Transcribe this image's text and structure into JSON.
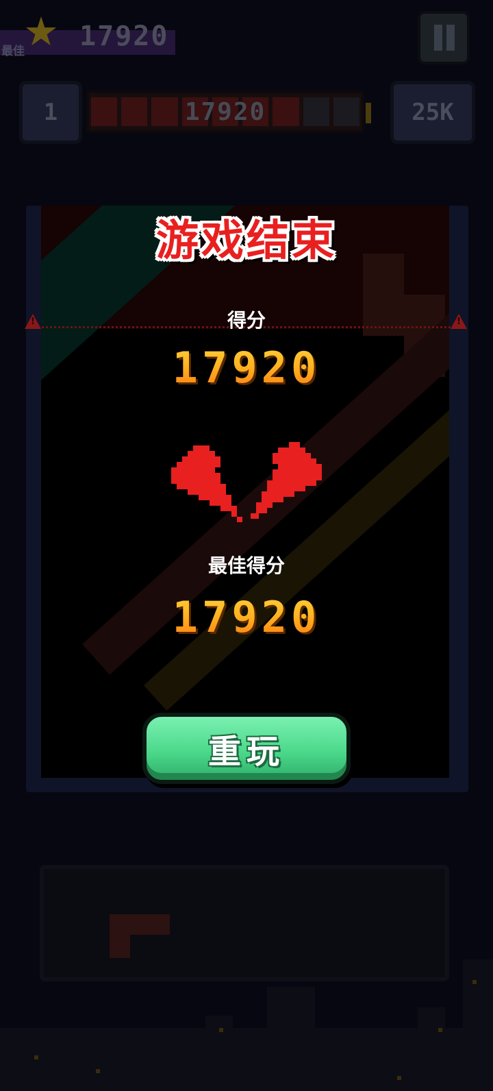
{
  "top_bar": {
    "best_label": "最佳",
    "best_value": "17920",
    "level": "1",
    "progress_value": "17920",
    "target": "25K"
  },
  "game_over": {
    "title": "游戏结束",
    "score_label": "得分",
    "score_value": "17920",
    "best_label": "最佳得分",
    "best_value": "17920",
    "replay_label": "重玩"
  },
  "colors": {
    "title_red": "#e82020",
    "score_gold": "#ffb020",
    "replay_green": "#4cd98c",
    "heart_red": "#e82020"
  },
  "icons": {
    "star": "star-icon",
    "pause": "pause-icon",
    "warning": "warning-icon",
    "heart": "broken-heart-icon"
  }
}
